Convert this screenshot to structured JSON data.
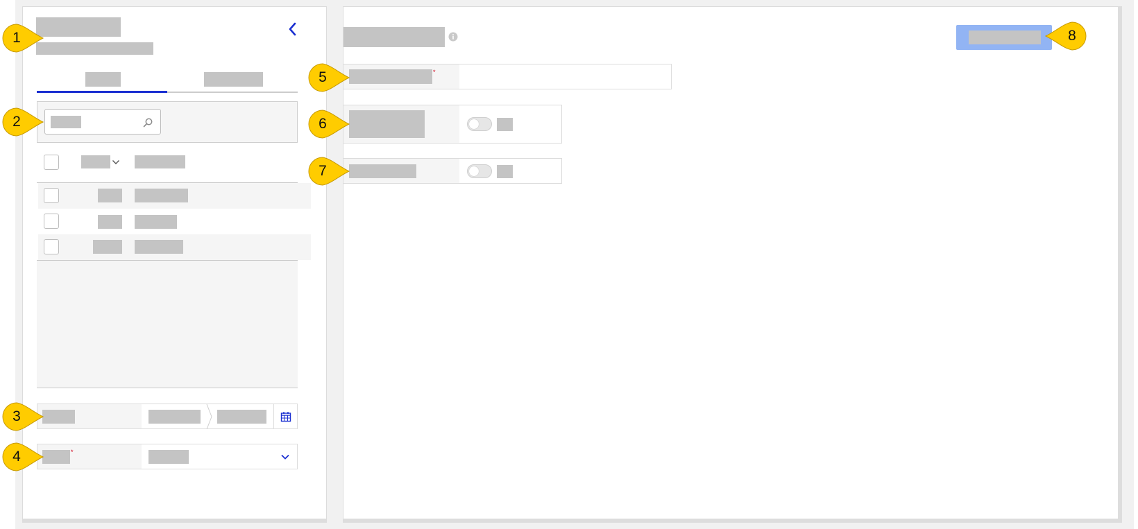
{
  "callouts": [
    "1",
    "2",
    "3",
    "4",
    "5",
    "6",
    "7",
    "8"
  ],
  "required_marker": "*",
  "colors": {
    "accent": "#1a2fd1",
    "primary_button": "#92b4f4",
    "placeholder": "#c4c4c4",
    "callout": "#ffcc00"
  },
  "icons": {
    "collapse": "chevron-left-icon",
    "search": "search-icon",
    "sort": "chevron-down-icon",
    "calendar": "calendar-icon",
    "dropdown": "chevron-down-icon",
    "info": "info-icon"
  }
}
